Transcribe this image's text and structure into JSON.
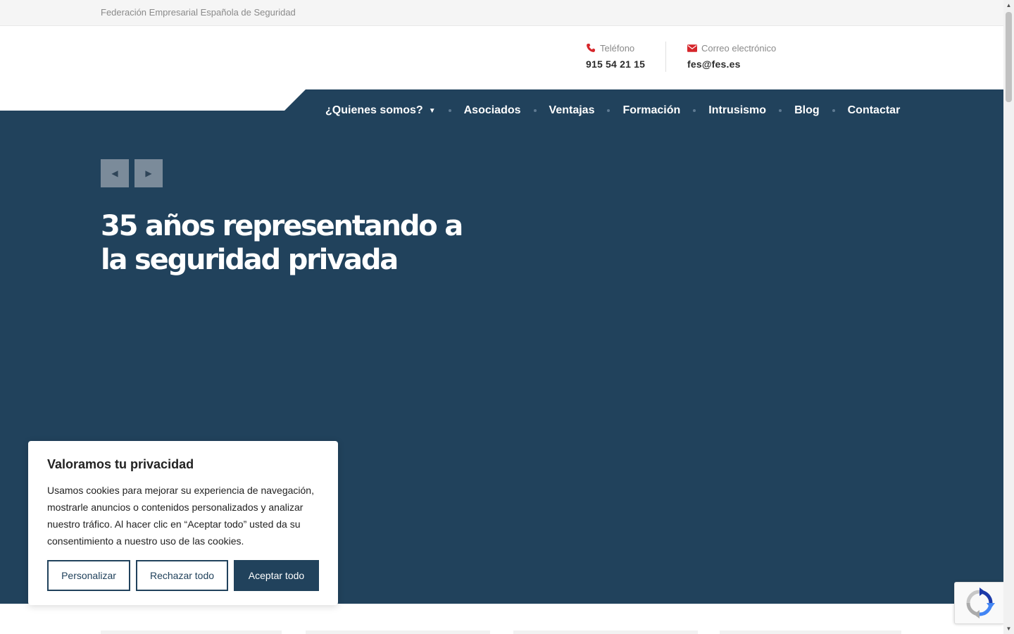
{
  "topbar": {
    "text": "Federación Empresarial Española de Seguridad"
  },
  "contacts": {
    "phone": {
      "label": "Teléfono",
      "value": "915 54 21 15",
      "icon": "phone-icon"
    },
    "email": {
      "label": "Correo electrónico",
      "value": "fes@fes.es",
      "icon": "envelope-icon"
    }
  },
  "nav": {
    "items": [
      {
        "label": "¿Quienes somos?",
        "has_dropdown": true
      },
      {
        "label": "Asociados"
      },
      {
        "label": "Ventajas"
      },
      {
        "label": "Formación"
      },
      {
        "label": "Intrusismo"
      },
      {
        "label": "Blog"
      },
      {
        "label": "Contactar"
      }
    ]
  },
  "hero": {
    "title": "35 años representando a la seguridad privada",
    "prev_icon": "arrow-left-icon",
    "next_icon": "arrow-right-icon"
  },
  "cookie": {
    "title": "Valoramos tu privacidad",
    "text": "Usamos cookies para mejorar su experiencia de navegación, mostrarle anuncios o contenidos personalizados y analizar nuestro tráfico. Al hacer clic en “Aceptar todo” usted da su consentimiento a nuestro uso de las cookies.",
    "buttons": {
      "customize": "Personalizar",
      "reject": "Rechazar todo",
      "accept": "Aceptar todo"
    }
  },
  "colors": {
    "brand_navy": "#21425c",
    "accent_red": "#d6262b",
    "topbar_bg": "#f5f5f5"
  }
}
